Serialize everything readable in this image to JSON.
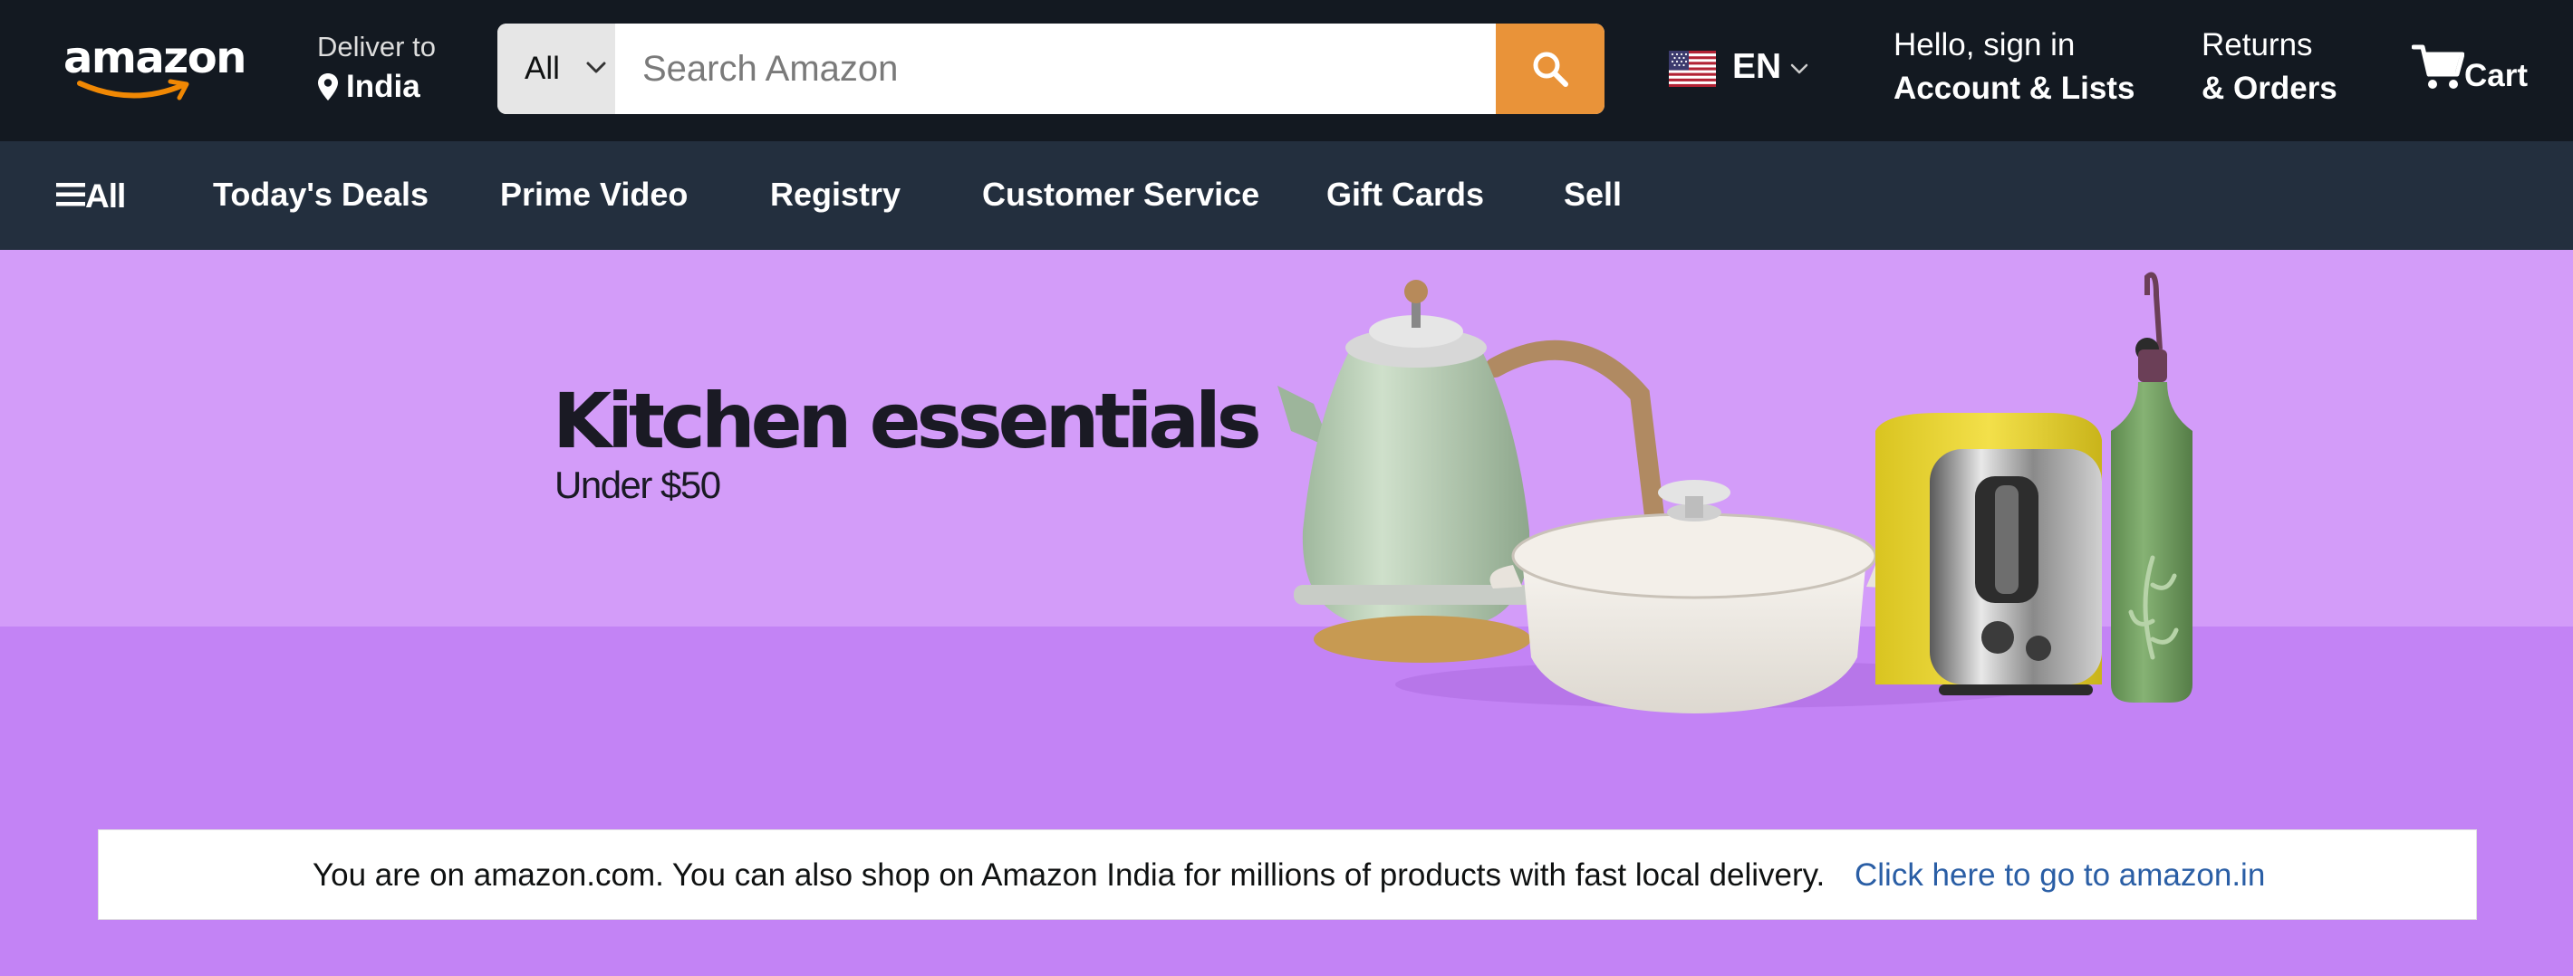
{
  "header": {
    "logo_text": "amazon",
    "deliver_label": "Deliver to",
    "deliver_country": "India",
    "search_category": "All",
    "search_placeholder": "Search Amazon",
    "search_value": "",
    "language_code": "EN",
    "account_greeting": "Hello, sign in",
    "account_label": "Account & Lists",
    "returns_label": "Returns",
    "orders_label": "& Orders",
    "cart_label": "Cart",
    "colors": {
      "header_bg": "#131921",
      "search_button": "#e99339",
      "search_category_bg": "#e6e6e6"
    }
  },
  "nav": {
    "all_label": "All",
    "items": [
      {
        "label": "Today's Deals"
      },
      {
        "label": "Prime Video"
      },
      {
        "label": "Registry"
      },
      {
        "label": "Customer Service"
      },
      {
        "label": "Gift Cards"
      },
      {
        "label": "Sell"
      }
    ],
    "colors": {
      "nav_bg": "#232f3e"
    }
  },
  "hero": {
    "title": "Kitchen essentials",
    "subtitle": "Under $50",
    "products": [
      "kettle",
      "casserole-pot",
      "toaster",
      "oil-bottle"
    ],
    "colors": {
      "background": "#c383f5",
      "wall": "#d39cf9"
    }
  },
  "notice": {
    "text": "You are on amazon.com. You can also shop on Amazon India for millions of products with fast local delivery.",
    "link_text": "Click here to go to amazon.in",
    "colors": {
      "link": "#2a5ea5"
    }
  },
  "icons": {
    "search": "search-icon",
    "location": "location-pin-icon",
    "flag": "us-flag-icon",
    "cart": "cart-icon",
    "menu": "hamburger-menu-icon"
  }
}
